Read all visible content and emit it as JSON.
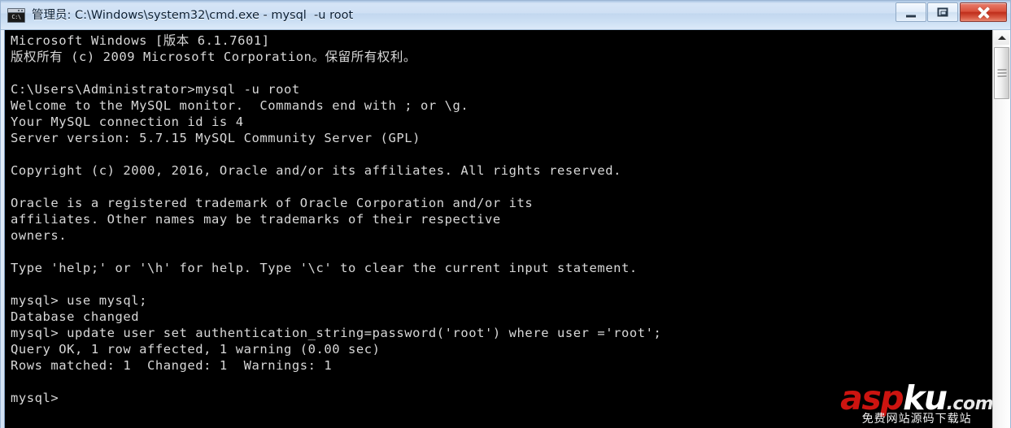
{
  "window": {
    "title": "管理员: C:\\Windows\\system32\\cmd.exe - mysql  -u root",
    "icon_name": "cmd-console-icon",
    "icon_text": "C:\\",
    "controls": {
      "minimize_label": "Minimize",
      "maximize_label": "Maximize",
      "close_label": "Close"
    },
    "colors": {
      "titlebar": "#cfe0f4",
      "close_button": "#bf2e1b",
      "console_background": "#000000",
      "console_text": "#d8d8d8"
    }
  },
  "console": {
    "lines": [
      "Microsoft Windows [版本 6.1.7601]",
      "版权所有 (c) 2009 Microsoft Corporation。保留所有权利。",
      "",
      "C:\\Users\\Administrator>mysql -u root",
      "Welcome to the MySQL monitor.  Commands end with ; or \\g.",
      "Your MySQL connection id is 4",
      "Server version: 5.7.15 MySQL Community Server (GPL)",
      "",
      "Copyright (c) 2000, 2016, Oracle and/or its affiliates. All rights reserved.",
      "",
      "Oracle is a registered trademark of Oracle Corporation and/or its",
      "affiliates. Other names may be trademarks of their respective",
      "owners.",
      "",
      "Type 'help;' or '\\h' for help. Type '\\c' to clear the current input statement.",
      "",
      "mysql> use mysql;",
      "Database changed",
      "mysql> update user set authentication_string=password('root') where user ='root';",
      "Query OK, 1 row affected, 1 warning (0.00 sec)",
      "Rows matched: 1  Changed: 1  Warnings: 1",
      "",
      "mysql>"
    ]
  },
  "scrollbar": {
    "up_arrow_name": "scroll-up-arrow",
    "thumb_name": "scroll-thumb"
  },
  "watermark": {
    "part_red": "asp",
    "part_white": "ku",
    "domain_suffix": ".com",
    "subtitle": "免费网站源码下载站"
  }
}
